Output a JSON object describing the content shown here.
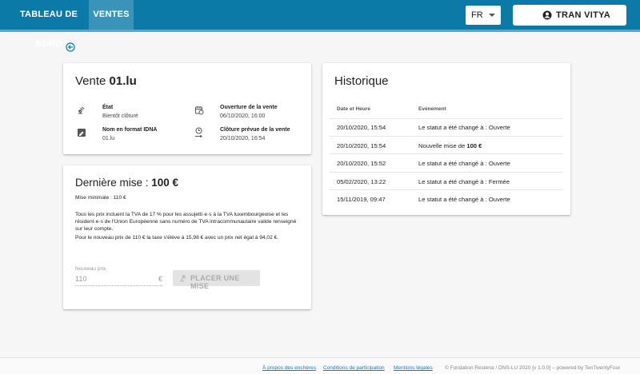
{
  "nav": {
    "dashboard": "TABLEAU DE BORD",
    "sales": "VENTES"
  },
  "lang": {
    "value": "FR"
  },
  "user": {
    "name": "TRAN VITYA"
  },
  "sale": {
    "title_prefix": "Vente",
    "domain": "01.lu",
    "state_label": "État",
    "state_value": "Bientôt clôturé",
    "idna_label": "Nom en format IDNA",
    "idna_value": "01.lu",
    "opening_label": "Ouverture de la vente",
    "opening_value": "06/10/2020, 16:00",
    "closing_label": "Clôture prévue de la vente",
    "closing_value": "20/10/2020, 16:54"
  },
  "bid": {
    "title": "Dernière mise : ",
    "amount": "100 €",
    "minimal": "Mise minimale : 110 €",
    "vat_note": "Tous les prix incluent la TVA de 17 % pour les assujetti·e·s à la TVA luxembourgeoise et les résident·e·s de l'Union Européenne sans numéro de TVA intracommunautaire valide renseigné sur leur compte.",
    "price_note": "Pour le nouveau prix de 110 € la taxe s'élève à 15,98 € avec un prix net égal à 94,02 €.",
    "input_label": "Nouveau prix",
    "input_value": "110",
    "currency": "€",
    "button": "PLACER UNE MISE"
  },
  "history": {
    "title": "Historique",
    "col_date": "Date et Heure",
    "col_event": "Evènement",
    "rows": [
      {
        "date": "20/10/2020, 15:54",
        "event": "Le statut a été changé à : Ouverte",
        "bold": ""
      },
      {
        "date": "20/10/2020, 15:54",
        "event": "Nouvelle mise de ",
        "bold": "100 €"
      },
      {
        "date": "20/10/2020, 15:52",
        "event": "Le statut a été changé à : Ouverte",
        "bold": ""
      },
      {
        "date": "05/02/2020, 13:22",
        "event": "Le statut a été changé à : Fermée",
        "bold": ""
      },
      {
        "date": "15/11/2019, 09:47",
        "event": "Le statut a été changé à : Ouverte",
        "bold": ""
      }
    ]
  },
  "footer": {
    "about": "À propos des enchères",
    "terms": "Conditions de participation",
    "legal": "Mentions légales",
    "copyright": "© Fondation Restena / DNS-LU 2020 [v 1.0.0] – powered by TenTwentyFour"
  },
  "colors": {
    "appbar": "#0c7aa6",
    "active_tab": "#3a94b9",
    "link": "#1a7bb2"
  }
}
